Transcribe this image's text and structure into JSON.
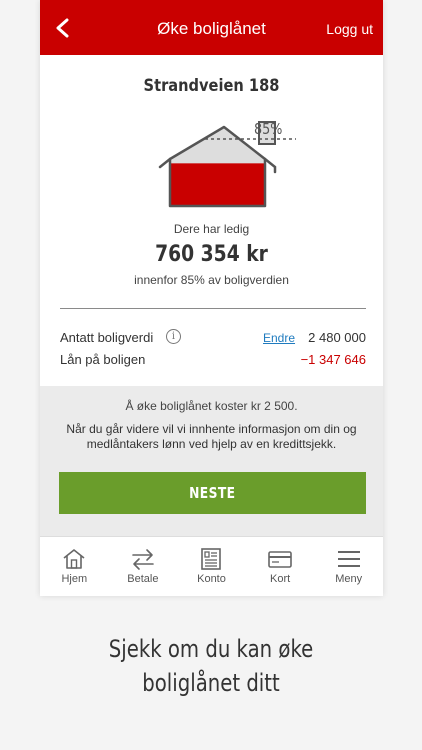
{
  "header": {
    "title": "Øke boliglånet",
    "logout_label": "Logg ut",
    "brand_color": "#c90000"
  },
  "property": {
    "address": "Strandveien 188",
    "ltv_limit_label": "85%",
    "ltv_fill_fraction": 0.54,
    "available_label": "Dere har ledig",
    "available_amount": "760 354 kr",
    "available_sub": "innenfor 85% av boligverdien"
  },
  "details": {
    "value_label": "Antatt boligverdi",
    "edit_label": "Endre",
    "value_amount": "2 480 000",
    "loan_label": "Lån på boligen",
    "loan_amount": "−1 347 646"
  },
  "info": {
    "cost_text": "Å øke boliglånet koster kr 2 500.",
    "consent_text": "Når du går videre vil vi innhente informasjon om din og medlåntakers lønn ved hjelp av en kredittsjekk.",
    "next_label": "NESTE",
    "button_color": "#6a9d2b"
  },
  "tabbar": {
    "items": [
      {
        "label": "Hjem",
        "icon": "home-icon"
      },
      {
        "label": "Betale",
        "icon": "transfer-arrows-icon"
      },
      {
        "label": "Konto",
        "icon": "account-document-icon"
      },
      {
        "label": "Kort",
        "icon": "card-icon"
      },
      {
        "label": "Meny",
        "icon": "menu-icon"
      }
    ]
  },
  "caption": {
    "line1": "Sjekk om du kan øke",
    "line2": "boliglånet ditt"
  }
}
